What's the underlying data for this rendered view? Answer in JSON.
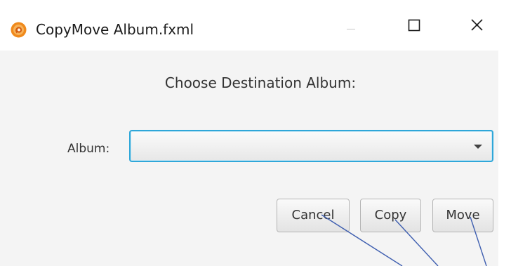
{
  "window": {
    "title": "CopyMove Album.fxml",
    "icon": "app-logo-icon",
    "controls": [
      "minimize-icon",
      "maximize-icon",
      "close-icon"
    ]
  },
  "dialog": {
    "heading": "Choose Destination Album:",
    "album_label": "Album:",
    "album_value": "",
    "buttons": {
      "cancel": "Cancel",
      "copy": "Copy",
      "move": "Move"
    }
  },
  "colors": {
    "focus_border": "#2fa7d9",
    "background": "#f4f4f4",
    "app_icon": "#f08a1c",
    "annotation_line": "#3f5fb0"
  }
}
